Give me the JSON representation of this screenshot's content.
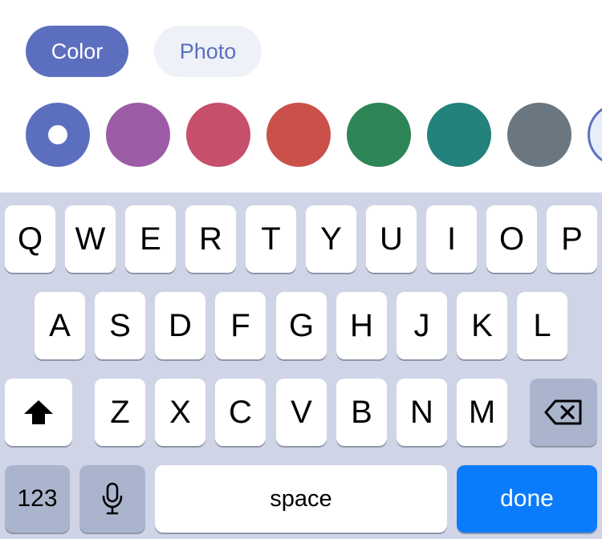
{
  "tabs": {
    "color_label": "Color",
    "photo_label": "Photo"
  },
  "swatches": {
    "colors": [
      "#5c6fbf",
      "#9c5ca6",
      "#c64f6c",
      "#c9514a",
      "#2e8556",
      "#23827b",
      "#6a7680"
    ],
    "selected_index": 0
  },
  "keyboard": {
    "row1": [
      "Q",
      "W",
      "E",
      "R",
      "T",
      "Y",
      "U",
      "I",
      "O",
      "P"
    ],
    "row2": [
      "A",
      "S",
      "D",
      "F",
      "G",
      "H",
      "J",
      "K",
      "L"
    ],
    "row3": [
      "Z",
      "X",
      "C",
      "V",
      "B",
      "N",
      "M"
    ],
    "shift_icon": "shift-icon",
    "backspace_icon": "backspace-icon",
    "numbers_label": "123",
    "mic_icon": "microphone-icon",
    "space_label": "space",
    "done_label": "done",
    "accent_color": "#0a7bfb"
  }
}
